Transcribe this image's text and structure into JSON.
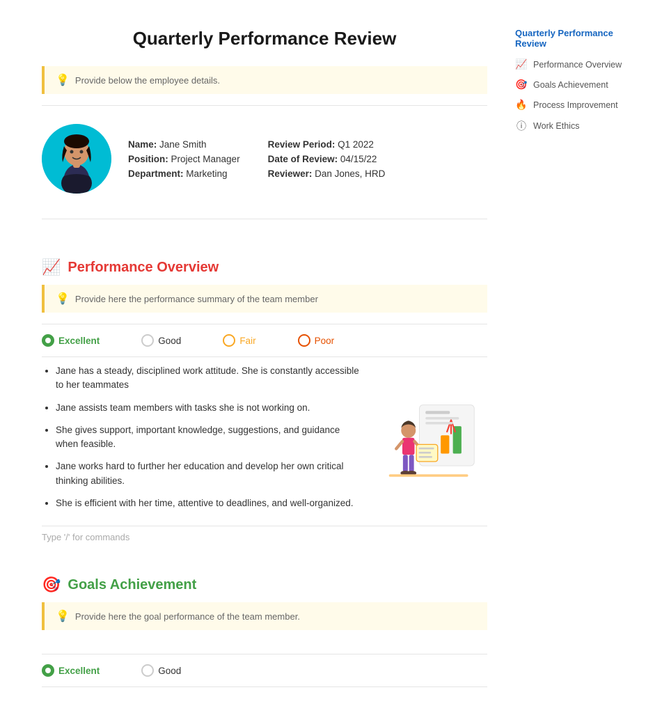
{
  "page": {
    "title": "Quarterly Performance Review"
  },
  "hint1": {
    "text": "Provide below the employee details."
  },
  "employee": {
    "name_label": "Name:",
    "name_value": "Jane Smith",
    "position_label": "Position:",
    "position_value": "Project Manager",
    "department_label": "Department:",
    "department_value": "Marketing",
    "review_period_label": "Review Period:",
    "review_period_value": "Q1 2022",
    "date_label": "Date of Review:",
    "date_value": "04/15/22",
    "reviewer_label": "Reviewer:",
    "reviewer_value": "Dan Jones, HRD"
  },
  "section1": {
    "title": "Performance Overview",
    "hint": "Provide here the performance summary of the team member",
    "rating_options": [
      "Excellent",
      "Good",
      "Fair",
      "Poor"
    ],
    "selected_rating": "Excellent",
    "bullets": [
      "Jane has a steady, disciplined work attitude. She is constantly accessible to her teammates",
      "Jane assists team members with tasks she is not working on.",
      "She gives support, important knowledge, suggestions, and guidance when feasible.",
      "Jane works hard to further her education and develop her own critical thinking abilities.",
      "She is efficient with her time, attentive to deadlines, and well-organized."
    ],
    "type_hint": "Type '/' for commands"
  },
  "section2": {
    "title": "Goals Achievement",
    "hint": "Provide here the goal performance of the team member."
  },
  "sidebar": {
    "title": "Quarterly Performance Review",
    "items": [
      {
        "icon": "📈",
        "label": "Performance Overview"
      },
      {
        "icon": "🎯",
        "label": "Goals Achievement"
      },
      {
        "icon": "🔥",
        "label": "Process Improvement"
      },
      {
        "icon": "ⓘ",
        "label": "Work Ethics"
      }
    ]
  }
}
